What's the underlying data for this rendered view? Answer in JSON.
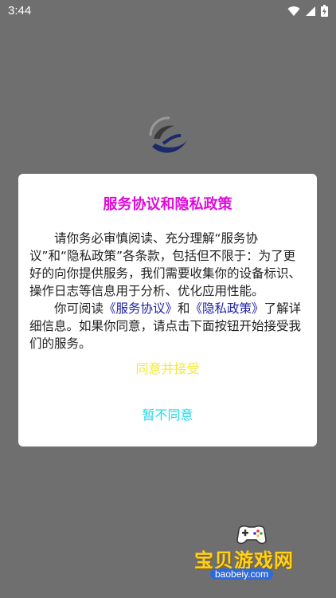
{
  "status_bar": {
    "time": "3:44",
    "icons": [
      "wifi-icon",
      "signal-icon",
      "battery-icon"
    ]
  },
  "dialog": {
    "title": "服务协议和隐私政策",
    "paragraph1": "请你务必审慎阅读、充分理解“服务协议”和“隐私政策”各条款，包括但不限于：为了更好的向你提供服务，我们需要收集你的设备标识、操作日志等信息用于分析、优化应用性能。",
    "paragraph2": {
      "prefix": "你可阅读",
      "link_service": "《服务协议》",
      "middle": "和",
      "link_privacy": "《隐私政策》",
      "suffix": "了解详细信息。如果你同意，请点击下面按钮开始接受我们的服务。"
    },
    "agree_label": "同意并接受",
    "disagree_label": "暂不同意"
  },
  "watermark": {
    "title": "宝贝游戏网",
    "url": "baobeiy.com"
  },
  "colors": {
    "backdrop": "#6f6f6f",
    "title": "#e10bdc",
    "link": "#1e22a8",
    "agree": "#f2ea3a",
    "disagree": "#25d6e6"
  }
}
